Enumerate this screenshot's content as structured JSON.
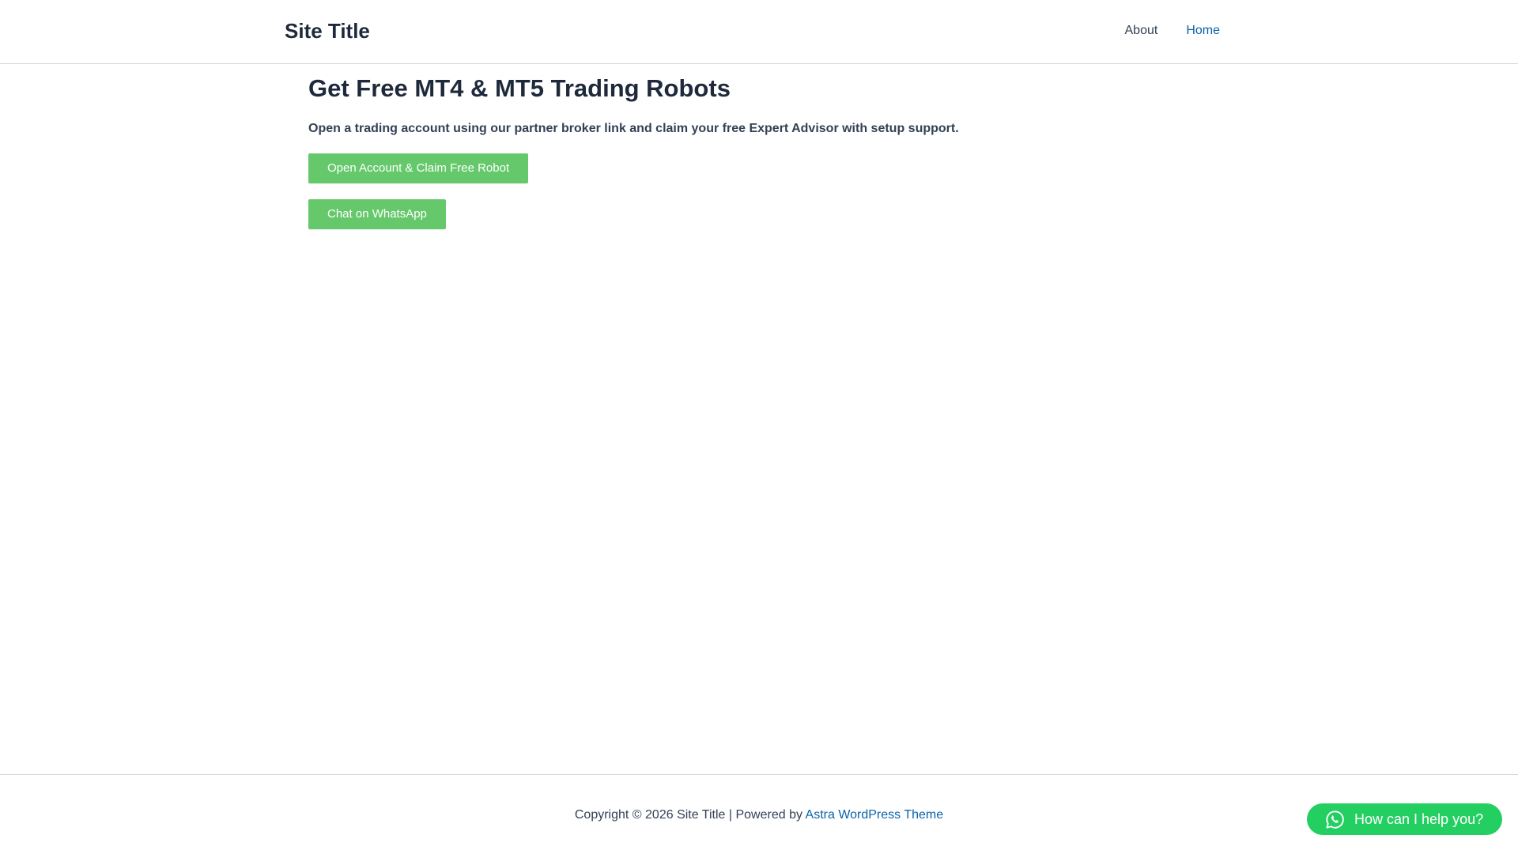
{
  "header": {
    "site_title": "Site Title",
    "nav": [
      {
        "label": "About",
        "active": false
      },
      {
        "label": "Home",
        "active": true
      }
    ]
  },
  "main": {
    "title": "Get Free MT4 & MT5 Trading Robots",
    "subtitle": "Open a trading account using our partner broker link and claim your free Expert Advisor with setup support.",
    "primary_button": "Open Account & Claim Free Robot",
    "secondary_button": "Chat on WhatsApp"
  },
  "footer": {
    "copyright_prefix": "Copyright © 2026 Site Title | Powered by ",
    "theme_link": "Astra WordPress Theme"
  },
  "whatsapp_widget": {
    "label": "How can I help you?",
    "icon": "whatsapp-icon"
  },
  "colors": {
    "button_green": "#65c86b",
    "widget_green": "#24cf61",
    "link_blue": "#0a63a8",
    "text_dark": "#1e293b"
  }
}
